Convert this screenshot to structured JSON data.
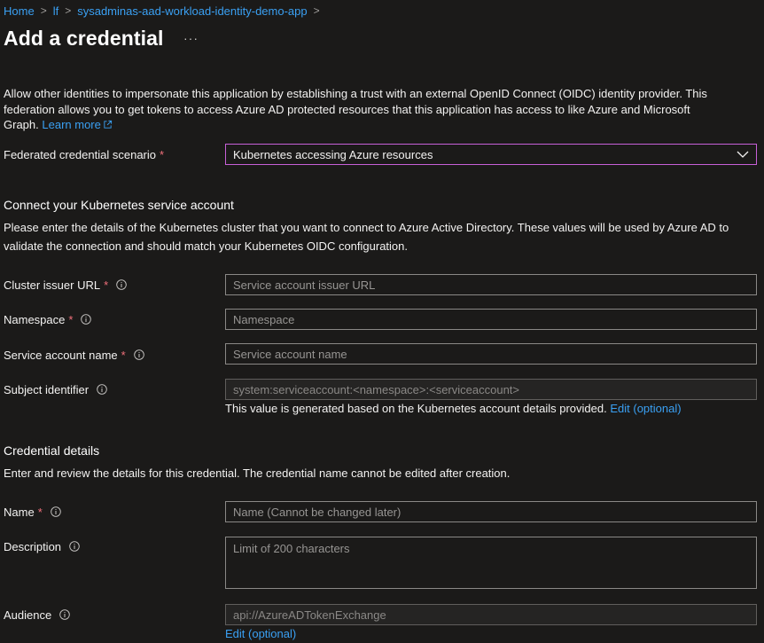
{
  "breadcrumb": [
    {
      "label": "Home"
    },
    {
      "label": "lf"
    },
    {
      "label": "sysadminas-aad-workload-identity-demo-app"
    }
  ],
  "page": {
    "title": "Add a credential",
    "more_label": "···"
  },
  "intro": {
    "text": "Allow other identities to impersonate this application by establishing a trust with an external OpenID Connect (OIDC) identity provider. This federation allows you to get tokens to access Azure AD protected resources that this application has access to like Azure and Microsoft Graph.",
    "learn_more": "Learn more"
  },
  "scenario": {
    "label": "Federated credential scenario",
    "value": "Kubernetes accessing Azure resources"
  },
  "k8s": {
    "title": "Connect your Kubernetes service account",
    "description": "Please enter the details of the Kubernetes cluster that you want to connect to Azure Active Directory. These values will be used by Azure AD to validate the connection and should match your Kubernetes OIDC configuration.",
    "issuer_label": "Cluster issuer URL",
    "issuer_placeholder": "Service account issuer URL",
    "namespace_label": "Namespace",
    "namespace_placeholder": "Namespace",
    "sa_label": "Service account name",
    "sa_placeholder": "Service account name",
    "subject_label": "Subject identifier",
    "subject_placeholder": "system:serviceaccount:<namespace>:<serviceaccount>",
    "subject_note": "This value is generated based on the Kubernetes account details provided.",
    "subject_edit": "Edit (optional)"
  },
  "credential": {
    "title": "Credential details",
    "description": "Enter and review the details for this credential. The credential name cannot be edited after creation.",
    "name_label": "Name",
    "name_placeholder": "Name (Cannot be changed later)",
    "description_label": "Description",
    "description_placeholder": "Limit of 200 characters",
    "audience_label": "Audience",
    "audience_placeholder": "api://AzureADTokenExchange",
    "audience_edit": "Edit (optional)"
  },
  "required_marker": "*",
  "colors": {
    "background": "#1b1a19",
    "link": "#3aa0f3",
    "required": "#f1707b",
    "dropdown_border": "#c760d8"
  }
}
